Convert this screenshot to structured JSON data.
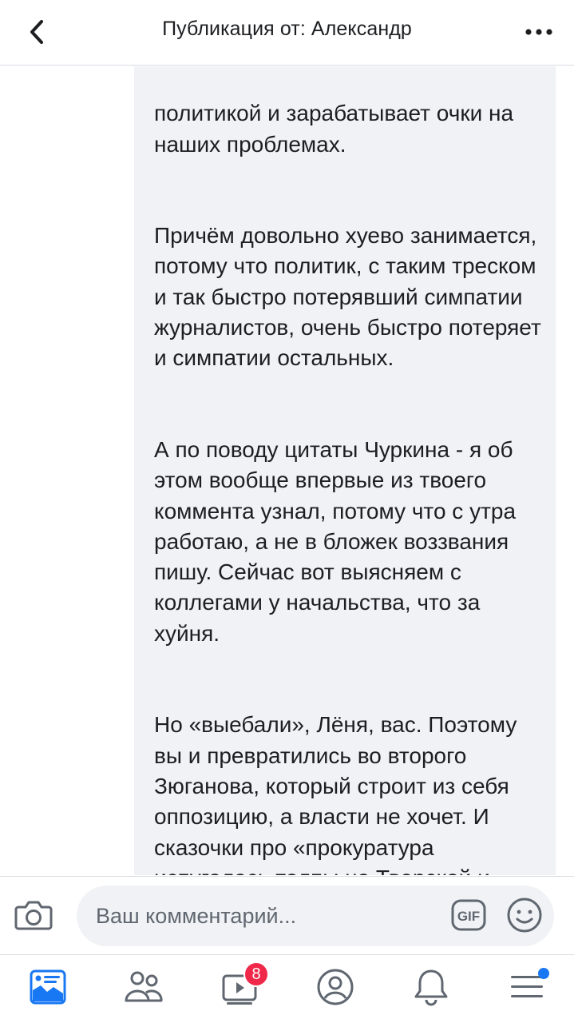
{
  "header": {
    "title": "Публикация от: Александр",
    "back_icon": "chevron-left-icon",
    "more_icon": "more-dots-icon"
  },
  "post": {
    "paragraphs": [
      "политикой и зарабатывает очки на наших проблемах.",
      "Причём довольно хуево занимается, потому что политик, с таким треском и так быстро потерявший симпатии журналистов, очень быстро потеряет и симпатии остальных.",
      "А по поводу цитаты Чуркина - я об этом вообще впервые из твоего коммента узнал, потому что с утра работаю, а не в бложек воззвания пишу. Сейчас вот выясняем с коллегами у начальства, что за хуйня.",
      "Но «выебали», Лёня, вас. Поэтому вы и превратились во второго Зюганова, который строит из себя оппозицию, а власти не хочет. И сказочки про «прокуратура испугалась толпы на Тверской и отменила приговор» оставь для"
    ]
  },
  "composer": {
    "placeholder": "Ваш комментарий...",
    "gif_label": "GIF"
  },
  "nav": {
    "items": [
      {
        "name": "news-feed",
        "icon": "news-feed-icon",
        "active": true
      },
      {
        "name": "friends",
        "icon": "friends-icon"
      },
      {
        "name": "watch",
        "icon": "video-icon",
        "badge": "8"
      },
      {
        "name": "profile",
        "icon": "profile-icon"
      },
      {
        "name": "notifications",
        "icon": "bell-icon"
      },
      {
        "name": "menu",
        "icon": "menu-icon",
        "dot": true
      }
    ],
    "watch_badge": "8"
  },
  "colors": {
    "accent": "#1877f2",
    "badge": "#f02849",
    "bubble": "#f0f2f5",
    "icon": "#606770"
  }
}
